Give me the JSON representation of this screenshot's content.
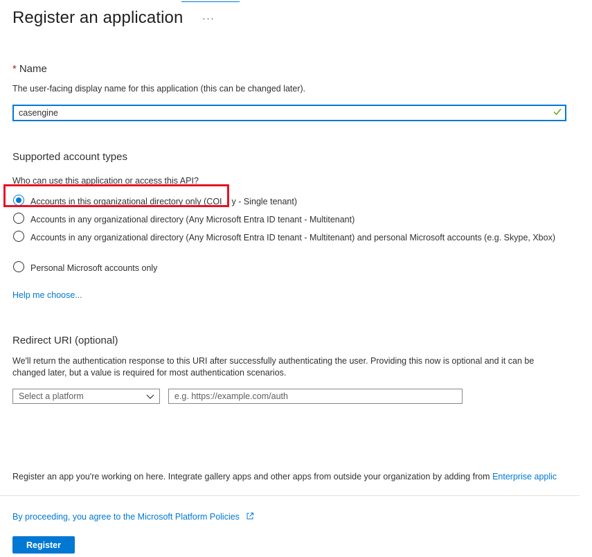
{
  "page": {
    "title": "Register an application",
    "more_label": "···"
  },
  "name_section": {
    "required_marker": "*",
    "heading": "Name",
    "description": "The user-facing display name for this application (this can be changed later).",
    "value": "casengine"
  },
  "account_types": {
    "heading": "Supported account types",
    "question": "Who can use this application or access this API?",
    "options": [
      {
        "label": "Accounts in this organizational directory only (COI",
        "label_tail": "y - Single tenant)",
        "selected": true
      },
      {
        "label": "Accounts in any organizational directory (Any Microsoft Entra ID tenant - Multitenant)",
        "selected": false
      },
      {
        "label": "Accounts in any organizational directory (Any Microsoft Entra ID tenant - Multitenant) and personal Microsoft accounts (e.g. Skype, Xbox)",
        "selected": false
      },
      {
        "label": "Personal Microsoft accounts only",
        "selected": false
      }
    ],
    "help_link": "Help me choose..."
  },
  "redirect": {
    "heading": "Redirect URI (optional)",
    "description": "We'll return the authentication response to this URI after successfully authenticating the user. Providing this now is optional and it can be changed later, but a value is required for most authentication scenarios.",
    "platform_placeholder": "Select a platform",
    "uri_placeholder": "e.g. https://example.com/auth"
  },
  "footer": {
    "note_text": "Register an app you're working on here. Integrate gallery apps and other apps from outside your organization by adding from ",
    "note_link": "Enterprise applic",
    "policy_link": "By proceeding, you agree to the Microsoft Platform Policies",
    "register_label": "Register"
  },
  "colors": {
    "accent": "#0078d4",
    "highlight": "#e81123",
    "success": "#57a300"
  }
}
